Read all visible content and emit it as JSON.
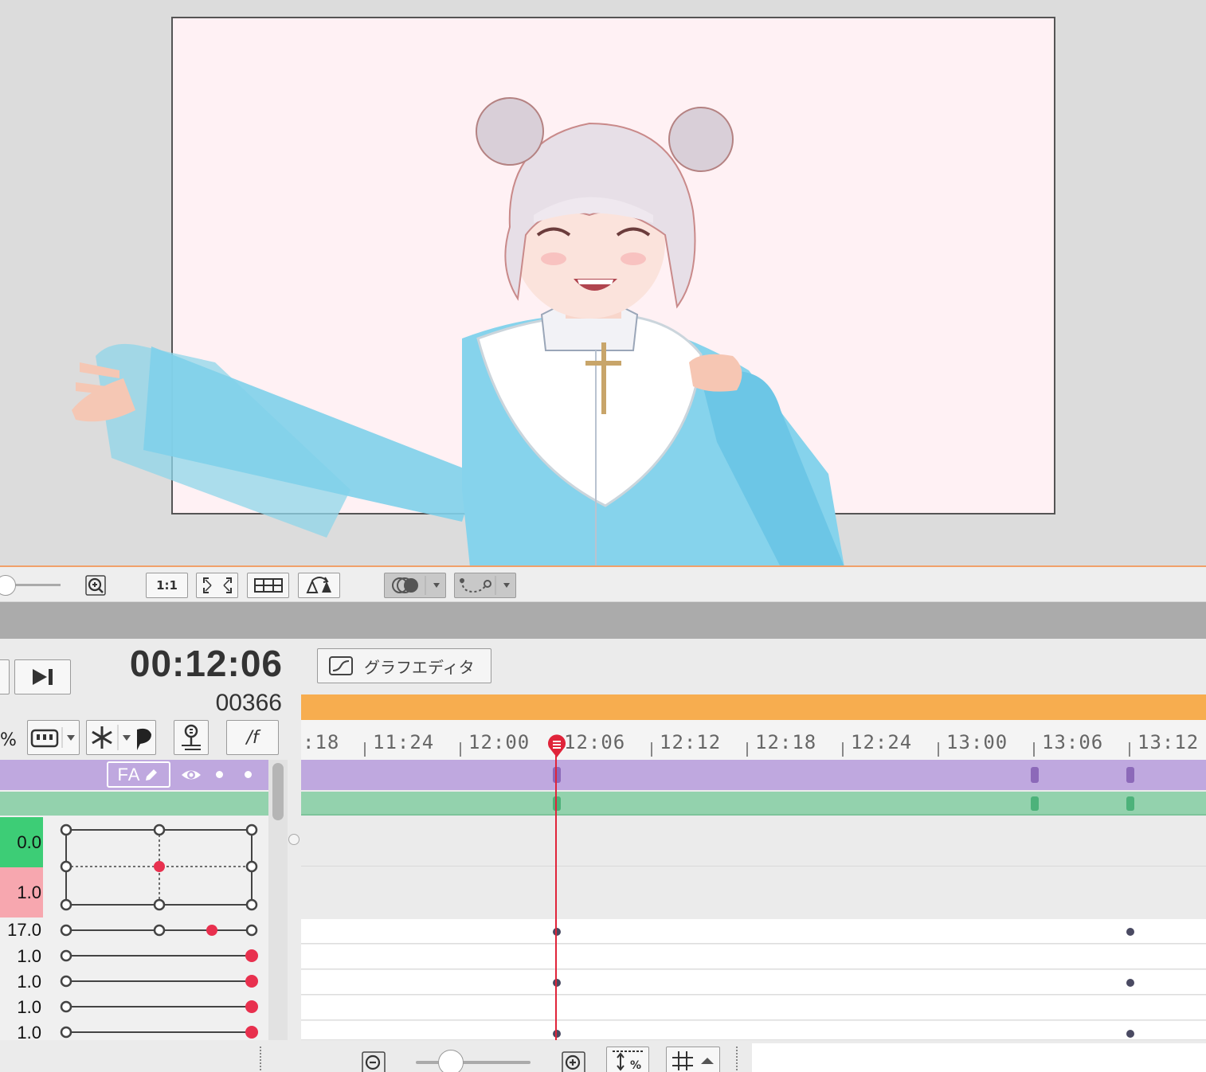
{
  "viewport": {
    "canvas_color": "#fff1f4",
    "frame_color": "#555555",
    "accent_border": "#f1a06a"
  },
  "view_toolbar": {
    "zoom_icon": "zoom-in-icon",
    "actual_size_label": "1:1",
    "fit_icon": "fit-screen-icon",
    "grid_icon": "grid-icon",
    "rotate_icon": "rotate-icon",
    "onion_icon": "onion-skin-icon",
    "path_icon": "motion-path-icon"
  },
  "timeline": {
    "timecode": "00:12:06",
    "frame_number": "00366",
    "graph_editor_label": "グラフエディタ",
    "pct_label": "%",
    "per_frame_label": "/f",
    "fa_label": "FA",
    "ruler_ticks": [
      ":18",
      "11:24",
      "12:00",
      "12:06",
      "12:12",
      "12:18",
      "12:24",
      "13:00",
      "13:06",
      "13:12"
    ],
    "colors": {
      "work_area": "#f7ad4f",
      "layer_purple": "#bfa8df",
      "layer_green": "#93d2ad",
      "playhead": "#e0243a",
      "value_green": "#3dcd76",
      "value_pink": "#f7a7af"
    }
  },
  "params": {
    "pos_x": "0.0",
    "pos_y": "1.0",
    "rows": [
      {
        "value": "17.0"
      },
      {
        "value": "1.0"
      },
      {
        "value": "1.0"
      },
      {
        "value": "1.0"
      },
      {
        "value": "1.0"
      }
    ]
  },
  "bottom_toolbar": {
    "zoom_out_icon": "zoom-out-icon",
    "zoom_in_icon": "zoom-in-icon",
    "fit_value_icon": "fit-value-icon",
    "grid_toggle_icon": "grid-snap-icon"
  }
}
